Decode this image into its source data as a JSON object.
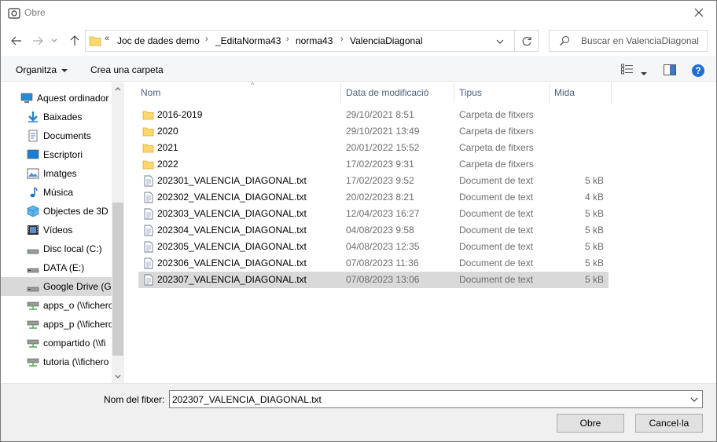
{
  "window": {
    "title": "Obre"
  },
  "address": {
    "overflow": "«",
    "crumbs": [
      "Joc de dades demo",
      "_EditaNorma43",
      "norma43",
      "ValenciaDiagonal"
    ]
  },
  "search": {
    "placeholder": "Buscar en ValenciaDiagonal"
  },
  "toolbar": {
    "organize_label": "Organitza",
    "new_folder_label": "Crea una carpeta"
  },
  "sidebar": {
    "items": [
      {
        "label": "Aquest ordinador",
        "icon": "computer-icon"
      },
      {
        "label": "Baixades",
        "icon": "downloads-icon"
      },
      {
        "label": "Documents",
        "icon": "documents-icon"
      },
      {
        "label": "Escriptori",
        "icon": "desktop-icon"
      },
      {
        "label": "Imatges",
        "icon": "pictures-icon"
      },
      {
        "label": "Música",
        "icon": "music-icon"
      },
      {
        "label": "Objectes de 3D",
        "icon": "3d-objects-icon"
      },
      {
        "label": "Vídeos",
        "icon": "videos-icon"
      },
      {
        "label": "Disc local (C:)",
        "icon": "drive-icon"
      },
      {
        "label": "DATA (E:)",
        "icon": "drive-icon"
      },
      {
        "label": "Google Drive (G:",
        "icon": "drive-icon"
      },
      {
        "label": "apps_o (\\\\fichero",
        "icon": "network-drive-icon"
      },
      {
        "label": "apps_p (\\\\fichero",
        "icon": "network-drive-icon"
      },
      {
        "label": "compartido (\\\\fi",
        "icon": "network-drive-icon"
      },
      {
        "label": "tutoria (\\\\fichero",
        "icon": "network-drive-icon"
      }
    ]
  },
  "columns": {
    "name": "Nom",
    "date": "Data de modificació",
    "type": "Tipus",
    "size": "Mida"
  },
  "files": [
    {
      "name": "2016-2019",
      "date": "29/10/2021 8:51",
      "type": "Carpeta de fitxers",
      "size": "",
      "kind": "folder"
    },
    {
      "name": "2020",
      "date": "29/10/2021 13:49",
      "type": "Carpeta de fitxers",
      "size": "",
      "kind": "folder"
    },
    {
      "name": "2021",
      "date": "20/01/2022 15:52",
      "type": "Carpeta de fitxers",
      "size": "",
      "kind": "folder"
    },
    {
      "name": "2022",
      "date": "17/02/2023 9:31",
      "type": "Carpeta de fitxers",
      "size": "",
      "kind": "folder"
    },
    {
      "name": "202301_VALENCIA_DIAGONAL.txt",
      "date": "17/02/2023 9:52",
      "type": "Document de text",
      "size": "5 kB",
      "kind": "file"
    },
    {
      "name": "202302_VALENCIA_DIAGONAL.txt",
      "date": "20/02/2023 8:21",
      "type": "Document de text",
      "size": "4 kB",
      "kind": "file"
    },
    {
      "name": "202303_VALENCIA_DIAGONAL.txt",
      "date": "12/04/2023 16:27",
      "type": "Document de text",
      "size": "5 kB",
      "kind": "file"
    },
    {
      "name": "202304_VALENCIA_DIAGONAL.txt",
      "date": "04/08/2023 9:58",
      "type": "Document de text",
      "size": "5 kB",
      "kind": "file"
    },
    {
      "name": "202305_VALENCIA_DIAGONAL.txt",
      "date": "04/08/2023 12:35",
      "type": "Document de text",
      "size": "5 kB",
      "kind": "file"
    },
    {
      "name": "202306_VALENCIA_DIAGONAL.txt",
      "date": "07/08/2023 11:36",
      "type": "Document de text",
      "size": "5 kB",
      "kind": "file"
    },
    {
      "name": "202307_VALENCIA_DIAGONAL.txt",
      "date": "07/08/2023 13:06",
      "type": "Document de text",
      "size": "5 kB",
      "kind": "file"
    }
  ],
  "footer": {
    "filename_label": "Nom del fitxer:",
    "filename_value": "202307_VALENCIA_DIAGONAL.txt",
    "open_label": "Obre",
    "cancel_label": "Cancel·la"
  },
  "colors": {
    "selection": "#d9d9d9",
    "accent": "#1a6fd6",
    "folder": "#ffd86b",
    "header_text": "#4c607a"
  }
}
